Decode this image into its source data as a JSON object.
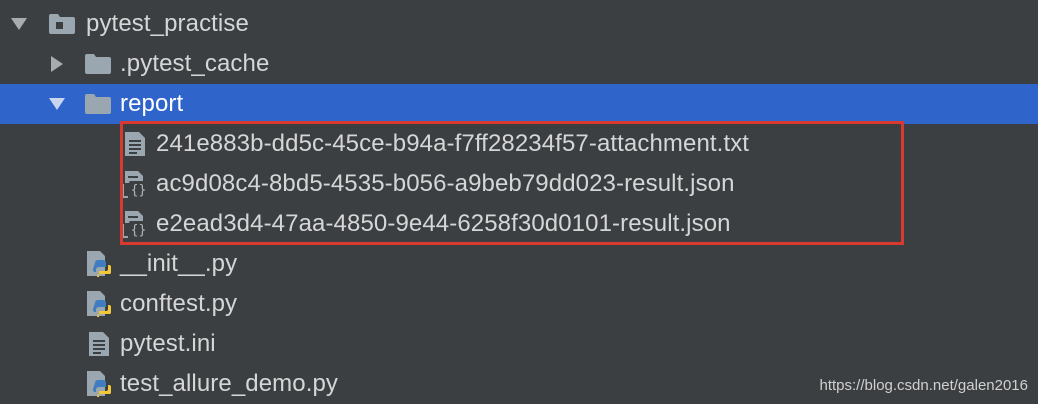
{
  "project_tree": {
    "root": {
      "label": "pytest_practise",
      "icon": "module-folder-icon",
      "expanded": true
    },
    "pytest_cache": {
      "label": ".pytest_cache",
      "icon": "folder-icon",
      "expanded": false
    },
    "report": {
      "label": "report",
      "icon": "folder-icon",
      "expanded": true,
      "selected": true,
      "children": [
        {
          "label": "241e883b-dd5c-45ce-b94a-f7ff28234f57-attachment.txt",
          "icon": "text-file-icon"
        },
        {
          "label": "ac9d08c4-8bd5-4535-b056-a9beb79dd023-result.json",
          "icon": "json-file-icon"
        },
        {
          "label": "e2ead3d4-47aa-4850-9e44-6258f30d0101-result.json",
          "icon": "json-file-icon"
        }
      ]
    },
    "files": [
      {
        "label": "__init__.py",
        "icon": "python-file-icon"
      },
      {
        "label": "conftest.py",
        "icon": "python-file-icon"
      },
      {
        "label": "pytest.ini",
        "icon": "text-file-icon"
      },
      {
        "label": "test_allure_demo.py",
        "icon": "python-file-icon"
      }
    ]
  },
  "watermark": "https://blog.csdn.net/galen2016",
  "colors": {
    "background": "#3c3f41",
    "selection": "#2f65ca",
    "text": "#d5d6d7",
    "highlight_border": "#d93a2f"
  }
}
